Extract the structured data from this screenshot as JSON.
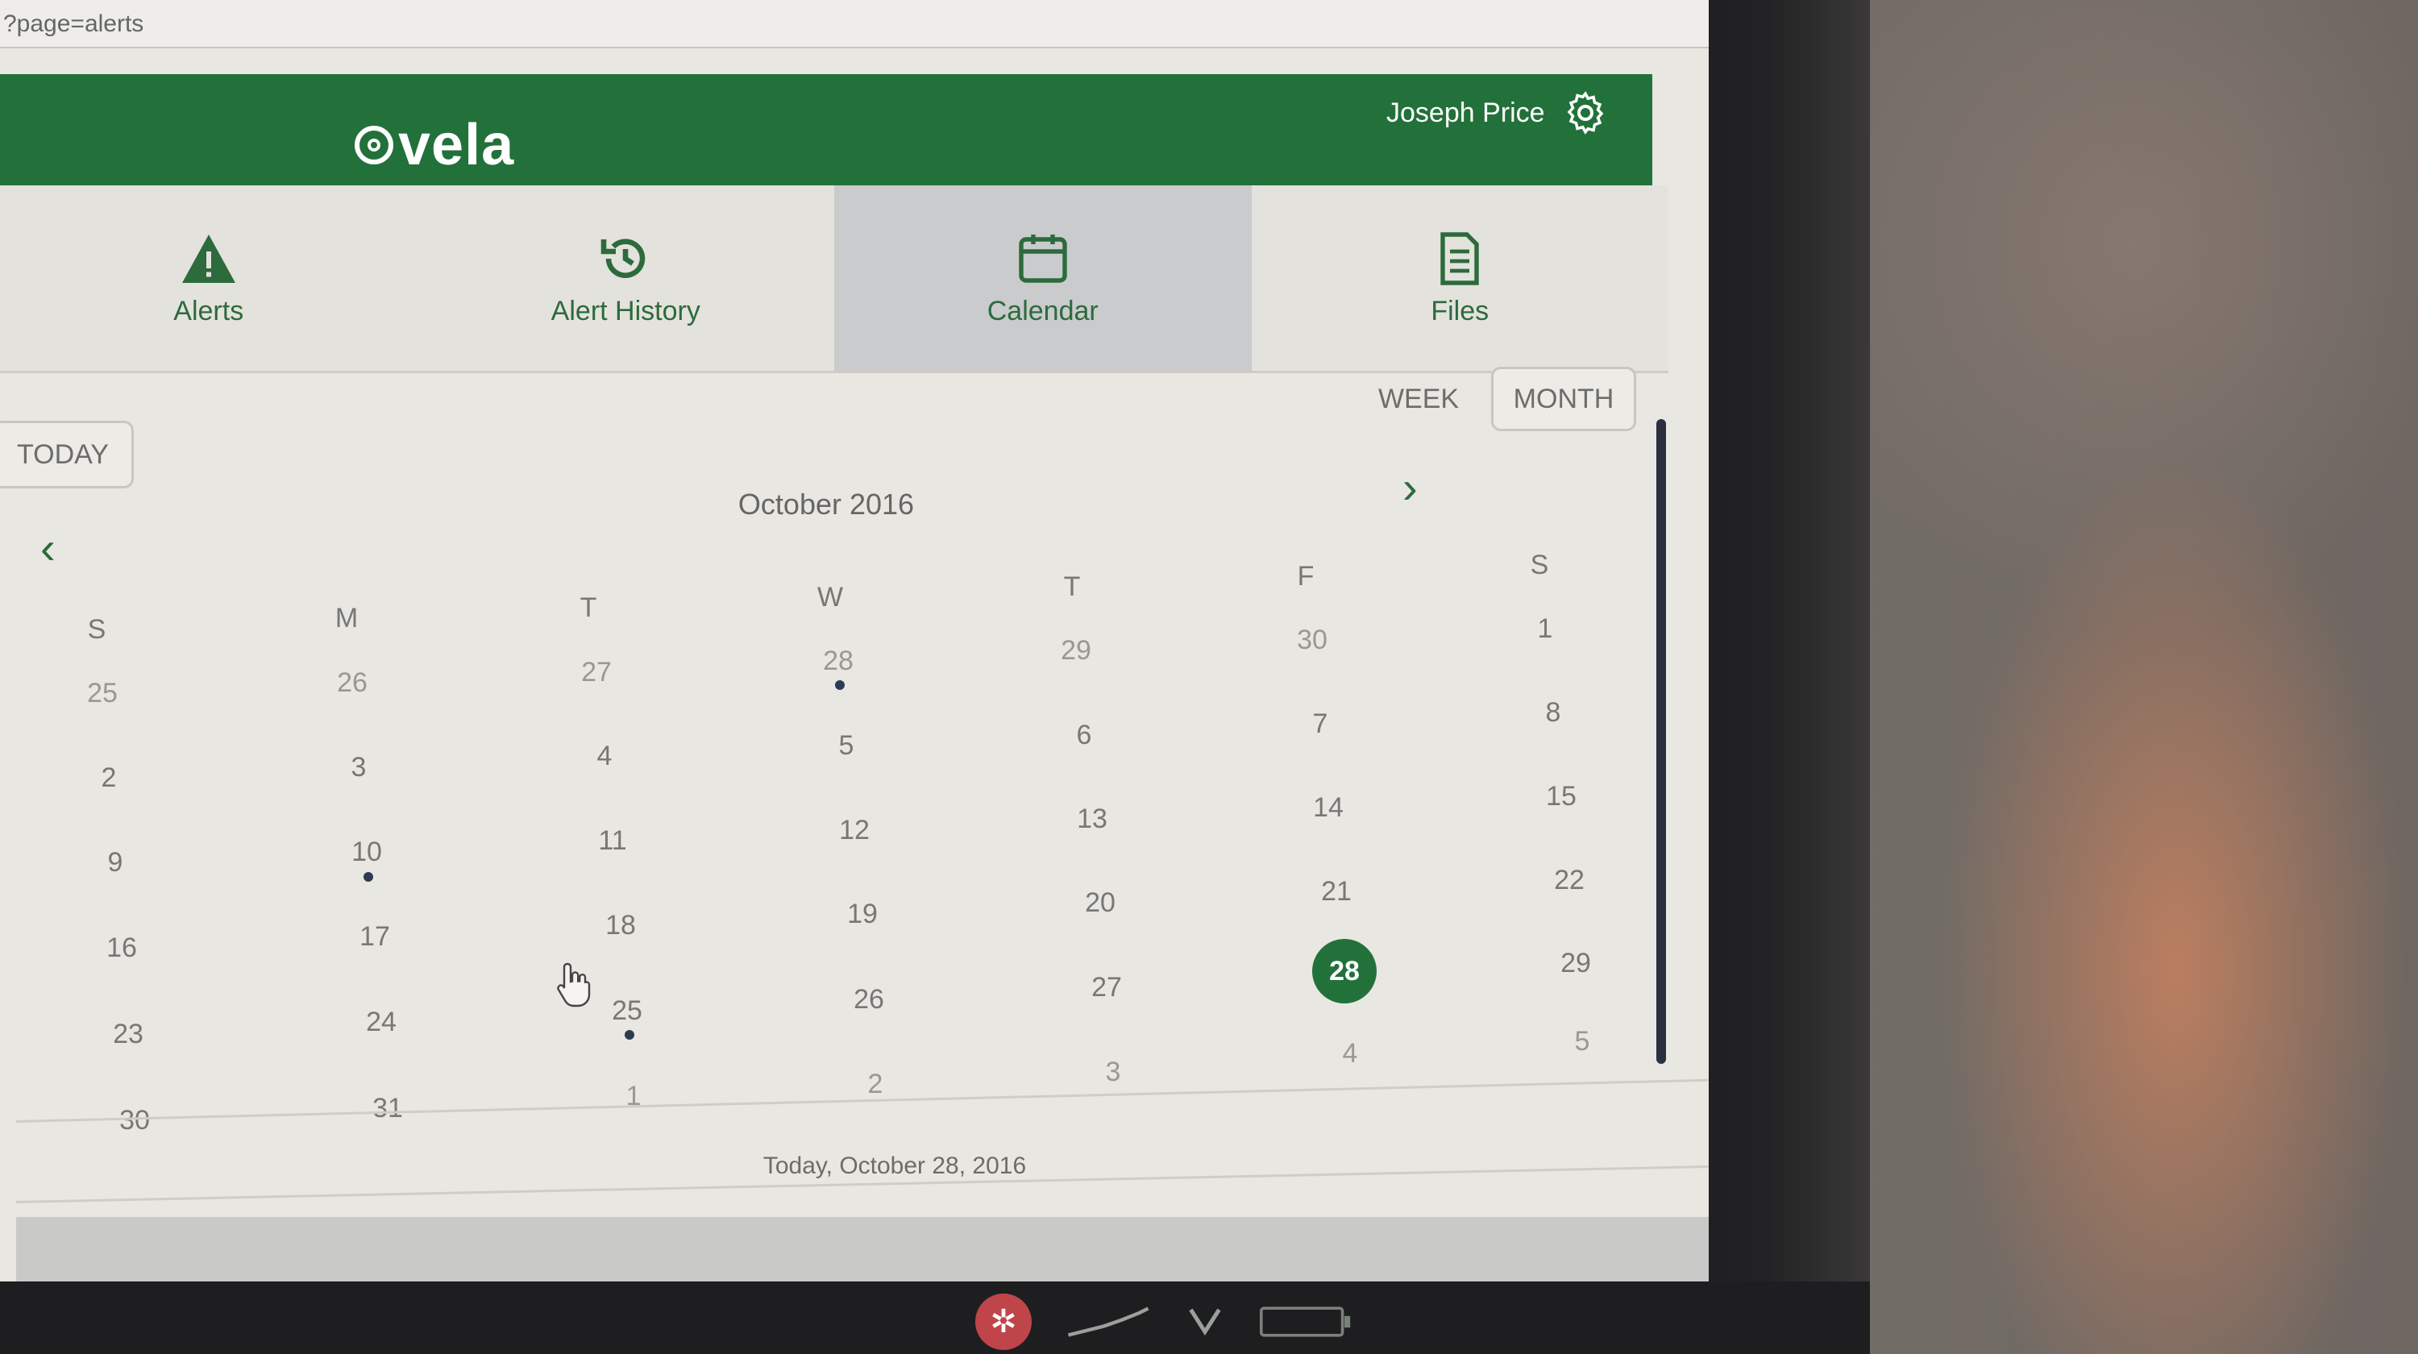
{
  "browser": {
    "url_fragment": "?page=alerts"
  },
  "header": {
    "logo_text": "vela",
    "user_name": "Joseph Price"
  },
  "nav": [
    {
      "label": "Alerts",
      "icon": "alert-triangle-icon"
    },
    {
      "label": "Alert History",
      "icon": "history-icon"
    },
    {
      "label": "Calendar",
      "icon": "calendar-icon",
      "active": true
    },
    {
      "label": "Files",
      "icon": "file-icon"
    }
  ],
  "calendar": {
    "today_button": "TODAY",
    "view_week": "WEEK",
    "view_month": "MONTH",
    "month_title": "October 2016",
    "prev": "‹",
    "next": "›",
    "weekdays": [
      "S",
      "M",
      "T",
      "W",
      "T",
      "F",
      "S"
    ],
    "weeks": [
      [
        "25",
        "26",
        "27",
        "28",
        "29",
        "30",
        "1"
      ],
      [
        "2",
        "3",
        "4",
        "5",
        "6",
        "7",
        "8"
      ],
      [
        "9",
        "10",
        "11",
        "12",
        "13",
        "14",
        "15"
      ],
      [
        "16",
        "17",
        "18",
        "19",
        "20",
        "21",
        "22"
      ],
      [
        "23",
        "24",
        "25",
        "26",
        "27",
        "28",
        "29"
      ],
      [
        "30",
        "31",
        "1",
        "2",
        "3",
        "4",
        "5"
      ]
    ],
    "selected_day": "28",
    "today_label": "Today, October 28, 2016"
  },
  "colors": {
    "brand_green": "#22713a",
    "event_dot": "#2c3b52"
  }
}
